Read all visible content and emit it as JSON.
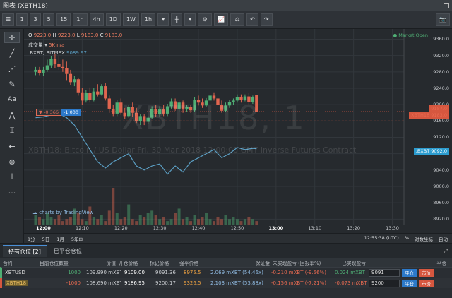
{
  "window": {
    "title": "图表 (XBTH18)"
  },
  "toolbar": {
    "intervals": [
      "1",
      "3",
      "5",
      "15",
      "1h",
      "4h",
      "1D",
      "1W",
      "1h"
    ]
  },
  "legend": {
    "o_label": "O",
    "o": "9223.0",
    "h_label": "H",
    "h": "9223.0",
    "l_label": "L",
    "l": "9183.0",
    "c_label": "C",
    "c": "9183.0",
    "volume_label": "成交量",
    "volume_value": "5K n/a",
    "index_label": ".BXBT, BITMEX",
    "index_value": "9089.97",
    "market_status": "● Market Open"
  },
  "watermark": {
    "symbol": "XBTH18, 1",
    "description": "XBTH18: Bitcoin / US Dollar Fri, 30 Mar 2018 12:00:00 GMT Inverse Futures Contract"
  },
  "price_axis": {
    "ticks": [
      "9360.0",
      "9320.0",
      "9280.0",
      "9240.0",
      "9200.0",
      "9160.0",
      "9120.0",
      "9080.0",
      "9040.0",
      "9000.0",
      "8960.0",
      "8920.0"
    ],
    "tag_last": "9187.0",
    "tag_xbth18": "XBTH18 9183.0",
    "tag_mark": "9160.0",
    "tag_index": ".BXBT 9092.0"
  },
  "position_line": {
    "pnl": "▼ -0.366",
    "qty": "-1 000"
  },
  "branding": {
    "tradingview": "charts by TradingView"
  },
  "time_axis": {
    "ticks": [
      "12:00",
      "12:10",
      "12:20",
      "12:30",
      "12:40",
      "12:50",
      "13:00",
      "13:10",
      "13:20",
      "13:30"
    ]
  },
  "bottom_bar": {
    "ranges": [
      "1分",
      "5日",
      "1月",
      "5年⊟"
    ],
    "clock": "12:55:38 (UTC)",
    "percent": "%",
    "log": "对数坐标",
    "auto": "自动"
  },
  "panel": {
    "tab_open": "持有仓位 [2]",
    "tab_closed": "已平仓仓位",
    "headers": [
      "合约",
      "目前仓位数量",
      "价值",
      "开仓价格",
      "标记价格",
      "强平价格",
      "保证金",
      "未实现盈亏 (回报率%)",
      "已实现盈亏",
      "平仓"
    ],
    "rows": [
      {
        "symbol": "XBTUSD",
        "qty": "1000",
        "value": "109.990 mXBT",
        "entry": "9109.00",
        "mark": "9091.36",
        "liq": "8975.5",
        "margin": "2.069 mXBT (54.46x)",
        "unrealised": "-0.210 mXBT (-9.56%)",
        "realised": "0.024 mXBT",
        "close_price": "9091",
        "close_btn": "平仓",
        "market_btn": "市价"
      },
      {
        "symbol": "XBTH18",
        "qty": "-1000",
        "value": "108.690 mXBT",
        "entry": "9186.95",
        "mark": "9200.17",
        "liq": "9326.5",
        "margin": "2.103 mXBT (53.88x)",
        "unrealised": "-0.156 mXBT (-7.21%)",
        "realised": "-0.073 mXBT",
        "close_price": "9200",
        "close_btn": "平仓",
        "market_btn": "市价"
      }
    ]
  },
  "colors": {
    "up": "#4fae74",
    "down": "#e0654f",
    "index_line": "#5b9fc4",
    "background": "#262a2e"
  },
  "chart_data": {
    "type": "candlestick",
    "interval": "1m",
    "x_axis": "time",
    "xlim": [
      "11:55",
      "13:33"
    ],
    "ylim": [
      8905,
      9385
    ],
    "candles": [
      {
        "t": "11:58",
        "o": 9280,
        "h": 9292,
        "c": 9285,
        "l": 9272
      },
      {
        "t": "11:59",
        "o": 9285,
        "h": 9292,
        "c": 9278,
        "l": 9272
      },
      {
        "t": "12:00",
        "o": 9278,
        "h": 9292,
        "c": 9285,
        "l": 9270
      },
      {
        "t": "12:01",
        "o": 9285,
        "h": 9310,
        "c": 9296,
        "l": 9280
      },
      {
        "t": "12:02",
        "o": 9296,
        "h": 9318,
        "c": 9312,
        "l": 9290
      },
      {
        "t": "12:03",
        "o": 9312,
        "h": 9325,
        "c": 9300,
        "l": 9290
      },
      {
        "t": "12:04",
        "o": 9300,
        "h": 9318,
        "c": 9292,
        "l": 9285
      },
      {
        "t": "12:05",
        "o": 9292,
        "h": 9310,
        "c": 9290,
        "l": 9280
      },
      {
        "t": "12:06",
        "o": 9290,
        "h": 9305,
        "c": 9275,
        "l": 9260
      },
      {
        "t": "12:07",
        "o": 9275,
        "h": 9285,
        "c": 9255,
        "l": 9248
      },
      {
        "t": "12:08",
        "o": 9255,
        "h": 9270,
        "c": 9262,
        "l": 9245
      },
      {
        "t": "12:09",
        "o": 9262,
        "h": 9266,
        "c": 9230,
        "l": 9222
      },
      {
        "t": "12:10",
        "o": 9230,
        "h": 9240,
        "c": 9210,
        "l": 9200
      },
      {
        "t": "12:11",
        "o": 9210,
        "h": 9235,
        "c": 9228,
        "l": 9205
      },
      {
        "t": "12:12",
        "o": 9228,
        "h": 9242,
        "c": 9212,
        "l": 9205
      },
      {
        "t": "12:13",
        "o": 9212,
        "h": 9240,
        "c": 9232,
        "l": 9208
      },
      {
        "t": "12:14",
        "o": 9232,
        "h": 9250,
        "c": 9225,
        "l": 9220
      },
      {
        "t": "12:15",
        "o": 9225,
        "h": 9250,
        "c": 9245,
        "l": 9222
      },
      {
        "t": "12:16",
        "o": 9245,
        "h": 9252,
        "c": 9215,
        "l": 9210
      },
      {
        "t": "12:17",
        "o": 9215,
        "h": 9222,
        "c": 9190,
        "l": 9180
      },
      {
        "t": "12:18",
        "o": 9190,
        "h": 9200,
        "c": 9178,
        "l": 9172
      },
      {
        "t": "12:19",
        "o": 9178,
        "h": 9212,
        "c": 9205,
        "l": 9172
      },
      {
        "t": "12:20",
        "o": 9205,
        "h": 9215,
        "c": 9180,
        "l": 9175
      },
      {
        "t": "12:21",
        "o": 9180,
        "h": 9192,
        "c": 9172,
        "l": 9165
      },
      {
        "t": "12:22",
        "o": 9172,
        "h": 9200,
        "c": 9195,
        "l": 9168
      },
      {
        "t": "12:23",
        "o": 9195,
        "h": 9205,
        "c": 9180,
        "l": 9170
      },
      {
        "t": "12:24",
        "o": 9180,
        "h": 9192,
        "c": 9160,
        "l": 9155
      },
      {
        "t": "12:25",
        "o": 9160,
        "h": 9176,
        "c": 9172,
        "l": 9150
      },
      {
        "t": "12:26",
        "o": 9172,
        "h": 9176,
        "c": 9158,
        "l": 9150
      },
      {
        "t": "12:27",
        "o": 9158,
        "h": 9172,
        "c": 9168,
        "l": 9152
      },
      {
        "t": "12:28",
        "o": 9168,
        "h": 9196,
        "c": 9190,
        "l": 9164
      },
      {
        "t": "12:29",
        "o": 9190,
        "h": 9200,
        "c": 9176,
        "l": 9170
      },
      {
        "t": "12:30",
        "o": 9176,
        "h": 9196,
        "c": 9188,
        "l": 9170
      },
      {
        "t": "12:31",
        "o": 9188,
        "h": 9200,
        "c": 9178,
        "l": 9172
      },
      {
        "t": "12:32",
        "o": 9178,
        "h": 9202,
        "c": 9196,
        "l": 9172
      },
      {
        "t": "12:33",
        "o": 9196,
        "h": 9215,
        "c": 9208,
        "l": 9190
      },
      {
        "t": "12:34",
        "o": 9208,
        "h": 9215,
        "c": 9190,
        "l": 9185
      },
      {
        "t": "12:35",
        "o": 9190,
        "h": 9210,
        "c": 9205,
        "l": 9182
      },
      {
        "t": "12:36",
        "o": 9205,
        "h": 9210,
        "c": 9188,
        "l": 9180
      },
      {
        "t": "12:37",
        "o": 9188,
        "h": 9200,
        "c": 9194,
        "l": 9182
      },
      {
        "t": "12:38",
        "o": 9194,
        "h": 9200,
        "c": 9186,
        "l": 9180
      },
      {
        "t": "12:39",
        "o": 9186,
        "h": 9218,
        "c": 9212,
        "l": 9182
      },
      {
        "t": "12:40",
        "o": 9212,
        "h": 9222,
        "c": 9205,
        "l": 9198
      },
      {
        "t": "12:41",
        "o": 9205,
        "h": 9215,
        "c": 9198,
        "l": 9192
      },
      {
        "t": "12:42",
        "o": 9198,
        "h": 9216,
        "c": 9210,
        "l": 9195
      },
      {
        "t": "12:43",
        "o": 9210,
        "h": 9225,
        "c": 9222,
        "l": 9205
      },
      {
        "t": "12:44",
        "o": 9222,
        "h": 9230,
        "c": 9215,
        "l": 9210
      },
      {
        "t": "12:45",
        "o": 9215,
        "h": 9222,
        "c": 9200,
        "l": 9195
      },
      {
        "t": "12:46",
        "o": 9200,
        "h": 9210,
        "c": 9185,
        "l": 9180
      },
      {
        "t": "12:47",
        "o": 9185,
        "h": 9205,
        "c": 9198,
        "l": 9182
      },
      {
        "t": "12:48",
        "o": 9198,
        "h": 9212,
        "c": 9206,
        "l": 9192
      },
      {
        "t": "12:49",
        "o": 9206,
        "h": 9215,
        "c": 9210,
        "l": 9200
      },
      {
        "t": "12:50",
        "o": 9210,
        "h": 9225,
        "c": 9218,
        "l": 9205
      },
      {
        "t": "12:51",
        "o": 9218,
        "h": 9225,
        "c": 9212,
        "l": 9205
      },
      {
        "t": "12:52",
        "o": 9212,
        "h": 9225,
        "c": 9220,
        "l": 9208
      },
      {
        "t": "12:53",
        "o": 9220,
        "h": 9228,
        "c": 9206,
        "l": 9200
      },
      {
        "t": "12:54",
        "o": 9206,
        "h": 9222,
        "c": 9218,
        "l": 9202
      },
      {
        "t": "12:55",
        "o": 9223,
        "h": 9223,
        "c": 9183,
        "l": 9183
      }
    ],
    "index_series": {
      "name": ".BXBT, BITMEX",
      "t": [
        "11:58",
        "12:00",
        "12:02",
        "12:04",
        "12:06",
        "12:08",
        "12:10",
        "12:12",
        "12:14",
        "12:16",
        "12:18",
        "12:20",
        "12:22",
        "12:24",
        "12:26",
        "12:28",
        "12:30",
        "12:32",
        "12:34",
        "12:36",
        "12:38",
        "12:40",
        "12:42",
        "12:44",
        "12:46",
        "12:48",
        "12:50",
        "12:52",
        "12:54",
        "12:55"
      ],
      "values": [
        9168,
        9170,
        9175,
        9178,
        9168,
        9150,
        9120,
        9090,
        9060,
        9045,
        9060,
        9070,
        9080,
        9050,
        9040,
        9050,
        9055,
        9030,
        9050,
        9035,
        9060,
        9070,
        9080,
        9090,
        9070,
        9080,
        9095,
        9090,
        9093,
        9092
      ]
    },
    "volume": [
      5,
      4,
      3,
      6,
      4,
      3,
      5,
      2,
      3,
      4,
      8,
      6,
      3,
      2,
      9,
      4,
      3,
      5,
      2,
      7,
      18,
      6,
      3,
      4,
      10,
      3,
      2,
      5,
      4,
      6,
      7,
      5,
      3,
      4,
      2,
      3,
      6,
      8,
      3,
      4,
      2,
      5,
      3,
      4,
      6,
      3,
      2,
      4,
      3,
      5,
      3,
      4,
      3,
      2,
      3,
      4,
      3,
      2,
      3,
      2
    ]
  }
}
